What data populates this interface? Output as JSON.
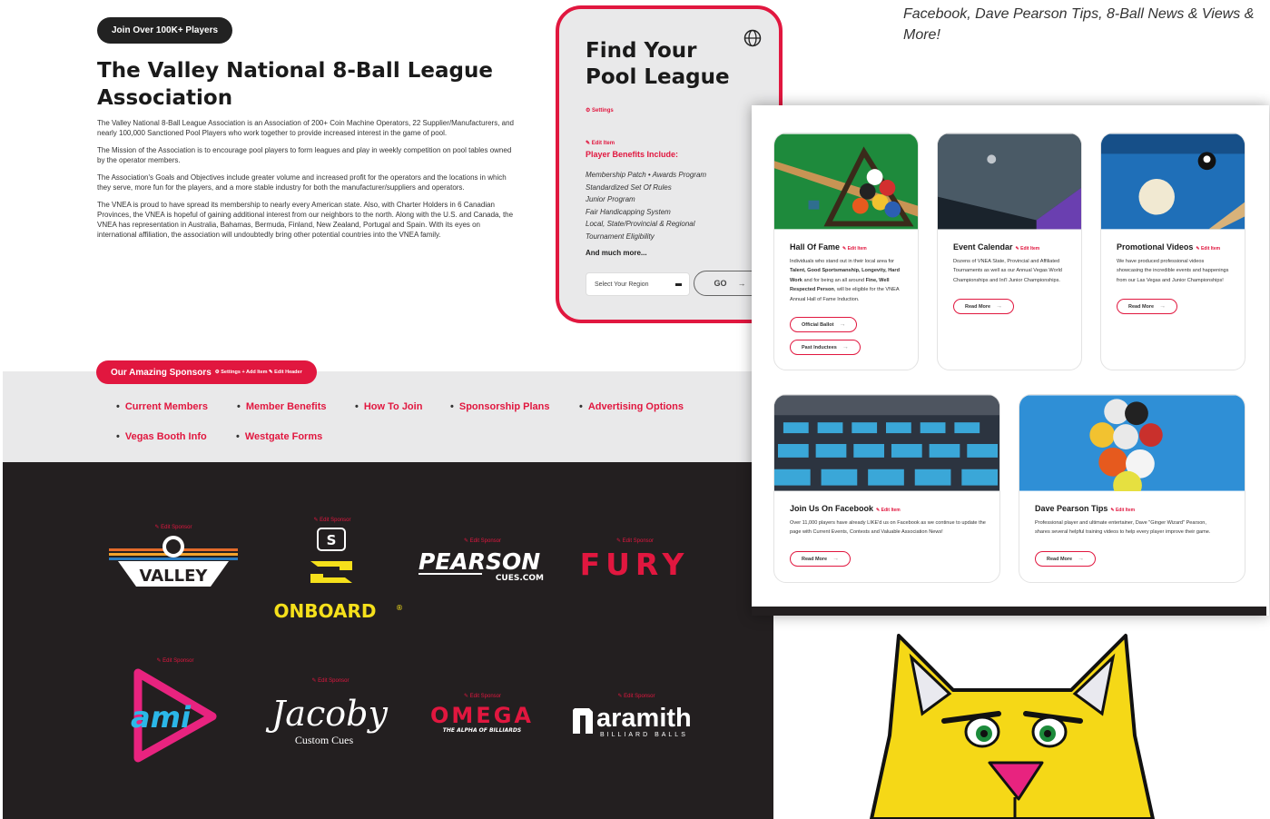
{
  "intro": {
    "badge": "Join Over 100K+ Players",
    "title": "The Valley National 8-Ball League Association",
    "paragraphs": [
      "The Valley National 8-Ball League Association is an Association of 200+ Coin Machine Operators, 22 Supplier/Manufacturers, and nearly 100,000 Sanctioned Pool Players who work together to provide increased interest in the game of pool.",
      "The Mission of the Association is to encourage pool players to form leagues and play in weekly competition on pool tables owned by the operator members.",
      "The Association's Goals and Objectives include greater volume and increased profit for the operators and the locations in which they serve, more fun for the players, and a more stable industry for both the manufacturer/suppliers and operators.",
      "The VNEA is proud to have spread its membership to nearly every American state. Also, with Charter Holders in 6 Canadian Provinces, the VNEA is hopeful of gaining additional interest from our neighbors to the north. Along with the U.S. and Canada, the VNEA has representation in Australia, Bahamas, Bermuda, Finland, New Zealand, Portugal and Spain. With its eyes on international affiliation, the association will undoubtedly bring other potential countries into the VNEA family."
    ]
  },
  "league": {
    "title": "Find Your Pool League",
    "settings": "⚙ Settings",
    "edit": "✎ Edit Item",
    "benefits_title": "Player Benefits Include:",
    "benefits": [
      "Membership Patch • Awards Program",
      "Standardized Set Of Rules",
      "Junior Program",
      "Fair Handicapping System",
      "Local, State/Provincial & Regional",
      "Tournament Eligibility"
    ],
    "more": "And much more...",
    "region_placeholder": "Select Your Region",
    "go": "GO",
    "go_arrow": "→"
  },
  "quote": "Facebook, Dave Pearson Tips, 8-Ball News & Views & More!",
  "sponsors": {
    "title": "Our Amazing Sponsors",
    "tools": "⚙ Settings + Add Item ✎ Edit Header",
    "nav": [
      "Current Members",
      "Member Benefits",
      "How To Join",
      "Sponsorship Plans",
      "Advertising Options",
      "Vegas Booth Info",
      "Westgate Forms"
    ],
    "edit_label": "✎ Edit Sponsor",
    "logos": {
      "valley": "VALLEY",
      "onboard_s": "S",
      "onboard": "ONBOARD",
      "onboard_reg": "®",
      "pearson": "PEARSON",
      "pearson_sub": "CUES.COM",
      "fury": "FURY",
      "ami": "ami",
      "jacoby": "Jacoby",
      "jacoby_sub": "Custom Cues",
      "omega": "OMEGA",
      "omega_sub": "THE ALPHA OF BILLIARDS",
      "aramith": "aramith",
      "aramith_sub": "BILLIARD BALLS"
    }
  },
  "features": [
    {
      "title": "Hall Of Fame",
      "edit": "✎ Edit Item",
      "text_parts": [
        "Individuals who stand out in their local area for ",
        "Talent, Good Sportsmanship, Longevity, Hard Work",
        " and for being an all around ",
        "Fine, Well Respected Person",
        ", will be eligible for the VNEA Annual Hall of Fame Induction."
      ],
      "buttons": [
        "Official Ballot",
        "Past Inductees"
      ]
    },
    {
      "title": "Event Calendar",
      "edit": "✎ Edit Item",
      "text": "Dozens of VNEA State, Provincial and Affiliated Tournaments as well as our Annual Vegas World Championships and Int'l Junior Championships.",
      "buttons": [
        "Read More"
      ]
    },
    {
      "title": "Promotional Videos",
      "edit": "✎ Edit Item",
      "text": "We have produced professional videos showcasing the incredible events and happenings from our Las Vegas and Junior Championships!",
      "buttons": [
        "Read More"
      ]
    },
    {
      "title": "Join Us On Facebook",
      "edit": "✎ Edit Item",
      "text": "Over 11,000 players have already LIKE'd us on Facebook as we continue to update the page with Current Events, Contests and Valuable Association News!",
      "buttons": [
        "Read More"
      ]
    },
    {
      "title": "Dave Pearson Tips",
      "edit": "✎ Edit Item",
      "text": "Professional player and ultimate entertainer, Dave \"Ginger Wizard\" Pearson, shares several helpful training videos to help every player improve their game.",
      "buttons": [
        "Read More"
      ]
    }
  ],
  "colors": {
    "accent": "#e1173f",
    "dark": "#231f20",
    "band": "#e9e9ea",
    "onboard": "#f5e01b",
    "ami_pink": "#e8237f",
    "ami_blue": "#2bb7e8"
  },
  "arrow": "→"
}
